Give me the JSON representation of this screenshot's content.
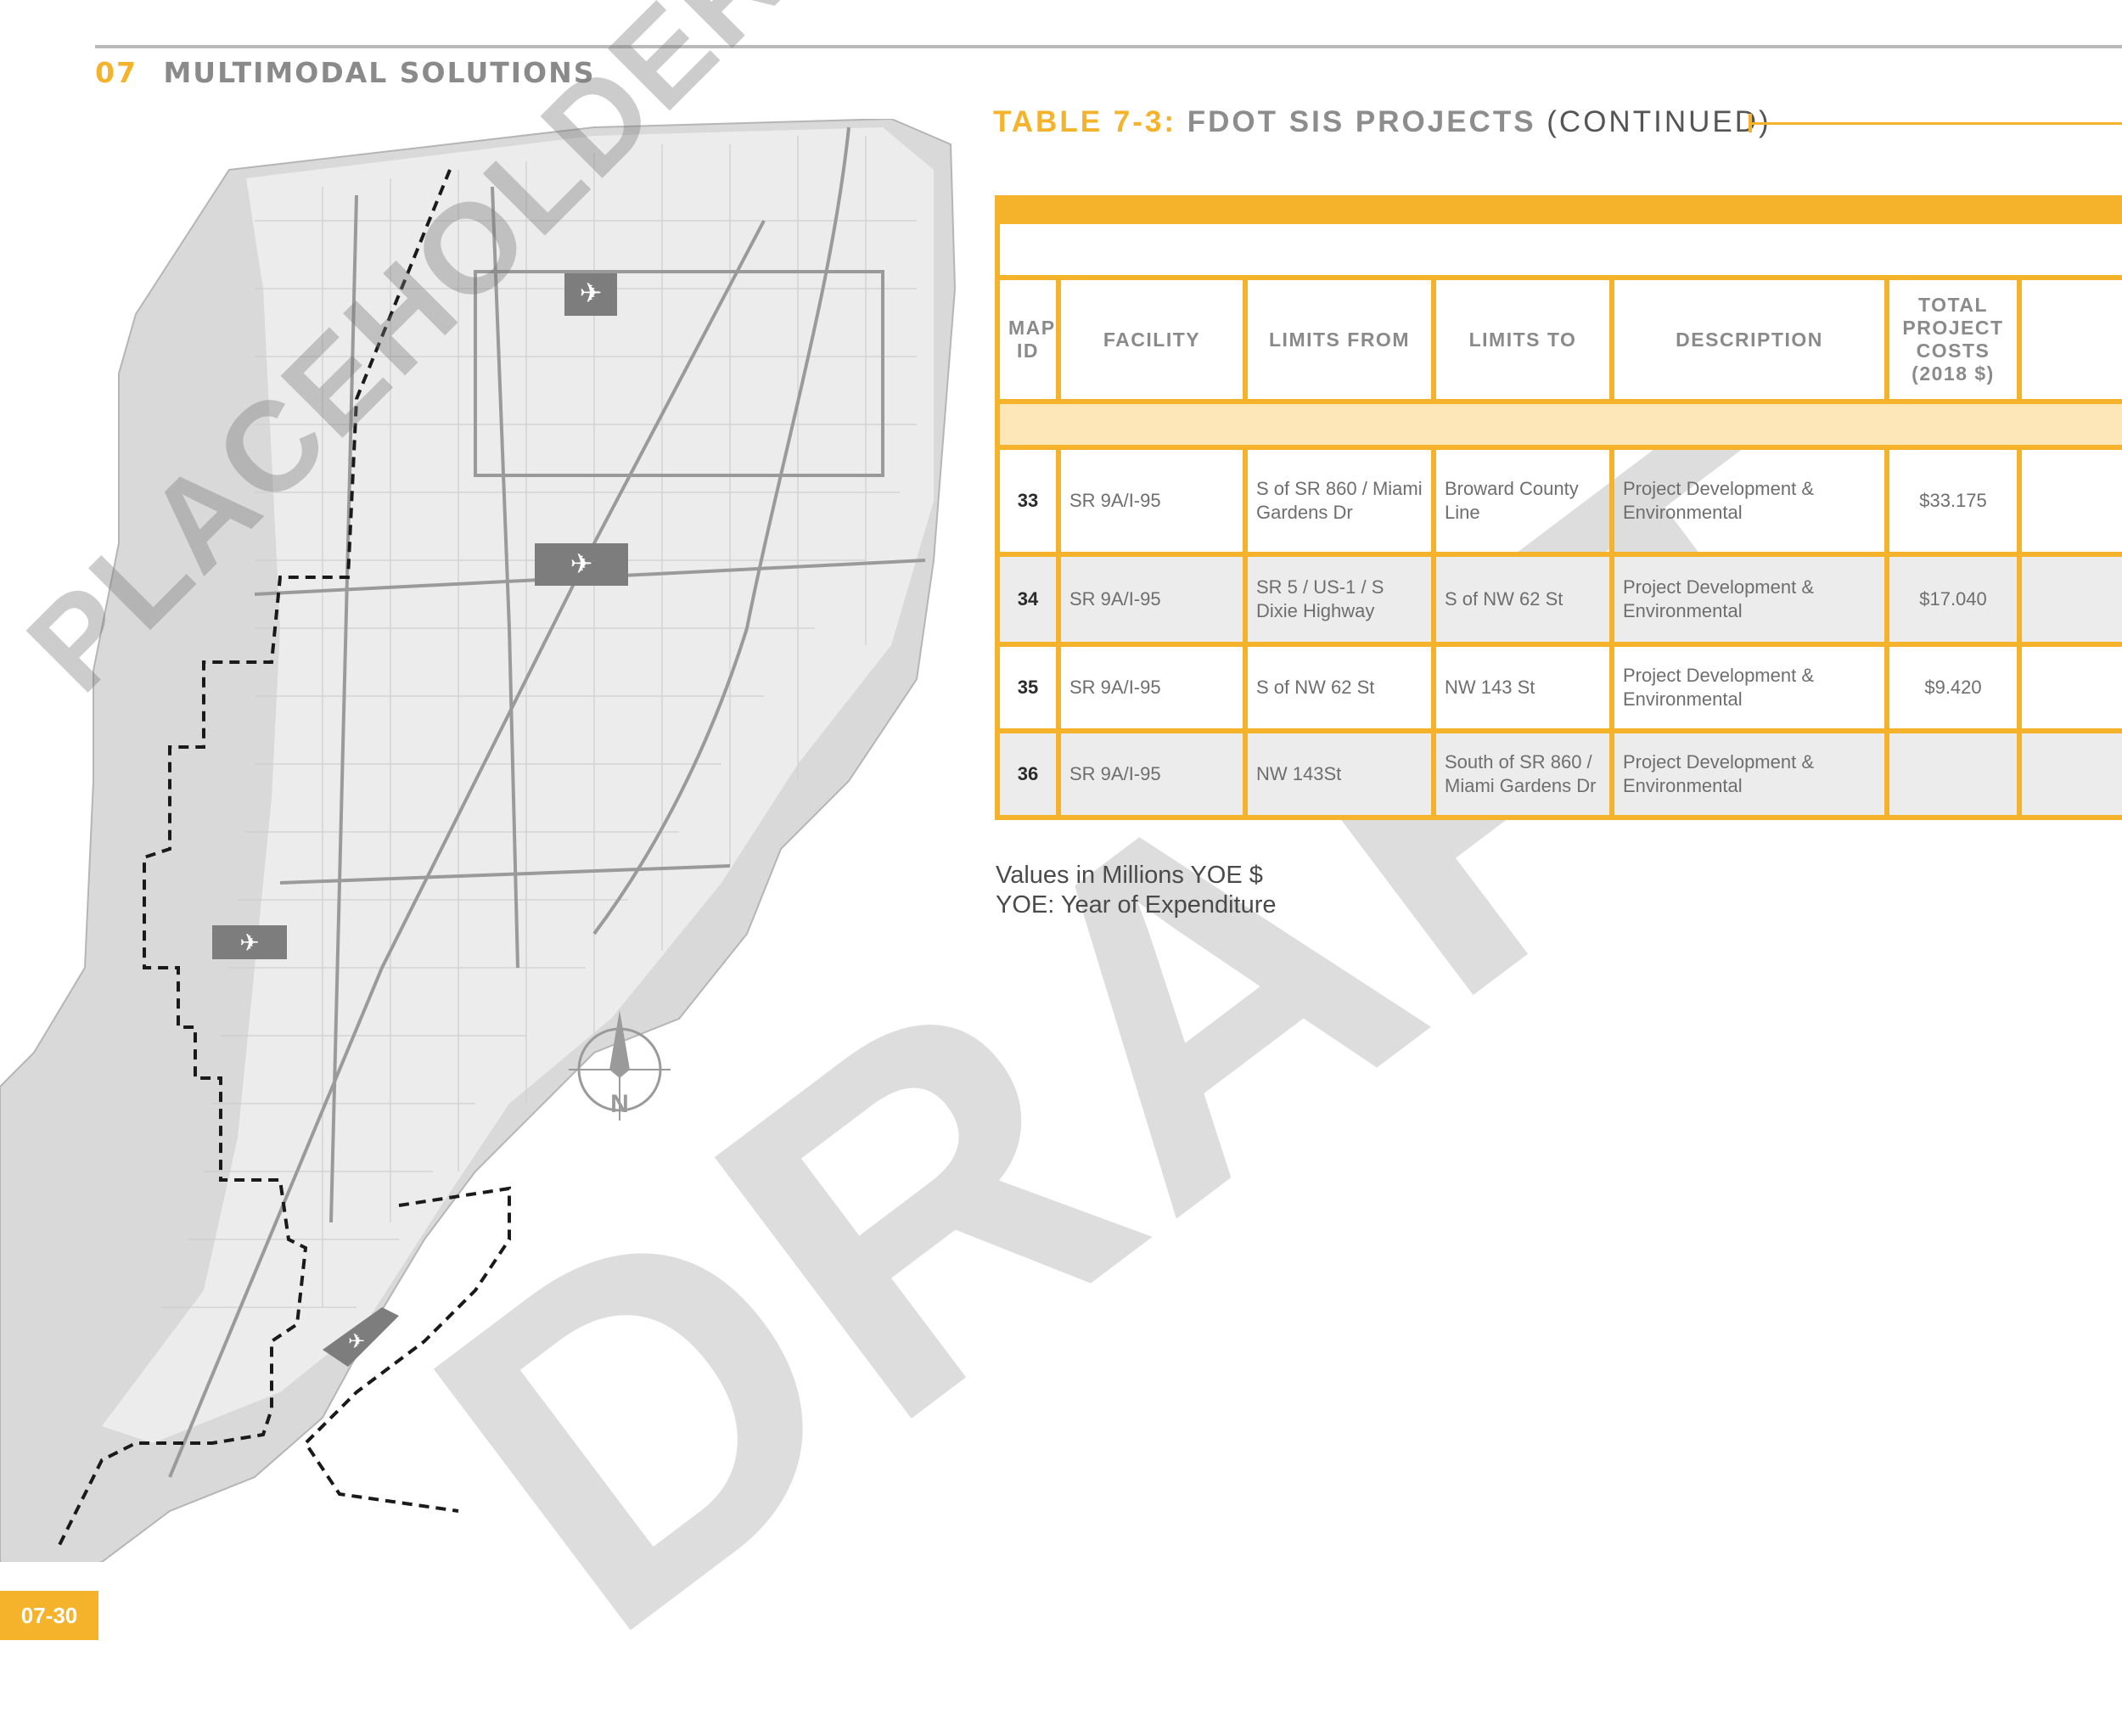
{
  "header": {
    "chapter_number": "07",
    "chapter_name": "MULTIMODAL SOLUTIONS"
  },
  "table": {
    "label": "TABLE 7-3:",
    "name": "FDOT SIS PROJECTS",
    "continued": "(CONTINUED)",
    "columns": [
      "MAP ID",
      "FACILITY",
      "LIMITS FROM",
      "LIMITS TO",
      "DESCRIPTION",
      "TOTAL PROJECT COSTS (2018 $)"
    ],
    "rows": [
      {
        "map_id": "33",
        "facility": "SR 9A/I-95",
        "limits_from": "S of SR 860 / Miami Gardens Dr",
        "limits_to": "Broward County Line",
        "description": "Project Development & Environmental",
        "cost": "$33.175"
      },
      {
        "map_id": "34",
        "facility": "SR 9A/I-95",
        "limits_from": "SR 5 / US-1 / S Dixie Highway",
        "limits_to": "S of NW 62 St",
        "description": "Project Development & Environmental",
        "cost": "$17.040"
      },
      {
        "map_id": "35",
        "facility": "SR 9A/I-95",
        "limits_from": "S of NW 62 St",
        "limits_to": "NW 143 St",
        "description": "Project Development & Environmental",
        "cost": "$9.420"
      },
      {
        "map_id": "36",
        "facility": "SR 9A/I-95",
        "limits_from": "NW 143St",
        "limits_to": "South of SR 860 / Miami Gardens Dr",
        "description": "Project Development & Environmental",
        "cost": ""
      }
    ]
  },
  "notes": {
    "line1": "Values in Millions YOE $",
    "line2": "YOE: Year of Expenditure"
  },
  "map": {
    "north_label": "N",
    "airport_icon": "airplane-icon",
    "colors": {
      "land": "#d6d6d6",
      "urban": "#e9e9e9",
      "road": "#9a9a9a",
      "boundary": "#1a1a1a",
      "airport": "#7d7d7d"
    }
  },
  "watermarks": {
    "draft": "DRAFT",
    "placeholder": "PLACEHOLDER"
  },
  "footer": {
    "page_number": "07-30"
  },
  "colors": {
    "accent": "#f4b32a",
    "accent_light": "#fde6b8",
    "row_alt": "#ececec"
  }
}
